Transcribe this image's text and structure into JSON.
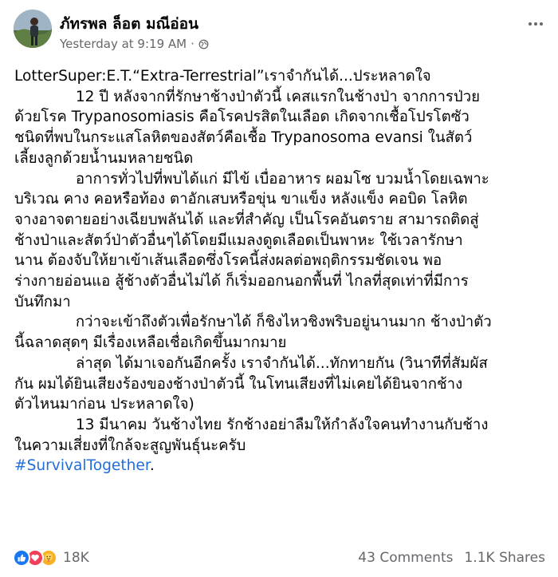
{
  "post": {
    "author": "ภัทรพล ล็อต มณีอ่อน",
    "timestamp": "Yesterday at 9:19 AM",
    "separator": "·",
    "privacy_icon": "globe-icon",
    "more_icon": "more-options-icon",
    "body": {
      "line1": "LotterSuper:E.T.“Extra-Terrestrial”เราจำกันได้...ประหลาดใจ",
      "line2": "             12 ปี หลังจากที่รักษาช้างป่าตัวนี้ เคสแรกในช้างป่า จากการป่วย",
      "line3": "ด้วยโรค Trypanosomiasis คือโรคปรสิตในเลือด เกิดจากเชื้อโปรโตซัว",
      "line4": "ชนิดที่พบในกระแสโลหิตของสัตว์คือเชื้อ Trypanosoma evansi ในสัตว์",
      "line5": "เลี้ยงลูกด้วยน้ำนมหลายชนิด",
      "line6": "             อาการทั่วไปที่พบได้แก่ มีไข้ เบื่ออาหาร ผอมโซ บวมน้ำโดยเฉพาะ",
      "line7": "บริเวณ คาง คอหรือท้อง ตาอักเสบหรือขุ่น ขาแข็ง หลังแข็ง คอบิด โลหิต",
      "line8": "จางอาจตายอย่างเฉียบพลันได้ และที่สำคัญ เป็นโรคอันตราย สามารถติดสู่",
      "line9": "ช้างป่าและสัตว์ป่าตัวอื่นๆได้โดยมีแมลงดูดเลือดเป็นพาหะ ใช้เวลารักษา",
      "line10": "นาน ต้องจับให้ยาเข้าเส้นเลือดซึ่งโรคนี้ส่งผลต่อพฤติกรรมชัดเจน พอ",
      "line11": "ร่างกายอ่อนแอ สู้ช้างตัวอื่นไม่ได้ ก็เริ่มออกนอกพื้นที่ ไกลที่สุดเท่าที่มีการ",
      "line12": "บันทึกมา",
      "line13": "             กว่าจะเข้าถึงตัวเพื่อรักษาได้ ก็ชิงไหวชิงพริบอยู่นานมาก ช้างป่าตัว",
      "line14": "นี้ฉลาดสุดๆ มีเรื่องเหลือเชื่อเกิดขึ้นมากมาย",
      "line15": "             ล่าสุด ได้มาเจอกันอีกครั้ง เราจำกันได้...ทักทายกัน (วินาทีที่สัมผัส",
      "line16": "กัน ผมได้ยินเสียงร้องของช้างป่าตัวนี้ ในโทนเสียงที่ไม่เคยได้ยินจากช้าง",
      "line17": "ตัวไหนมาก่อน ประหลาดใจ)",
      "line18": "             13 มีนาคม วันช้างไทย รักช้างอย่าลืมให้กำลังใจคนทำงานกับช้าง",
      "line19": "ในความเสี่ยงที่ใกล้จะสูญพันธุ์นะครับ",
      "hashtag": "#SurvivalTogether",
      "hashtag_suffix": "."
    },
    "reactions": {
      "icons": [
        "like-icon",
        "love-icon",
        "care-icon"
      ],
      "count": "18K"
    },
    "comments": "43 Comments",
    "shares": "1.1K Shares"
  }
}
